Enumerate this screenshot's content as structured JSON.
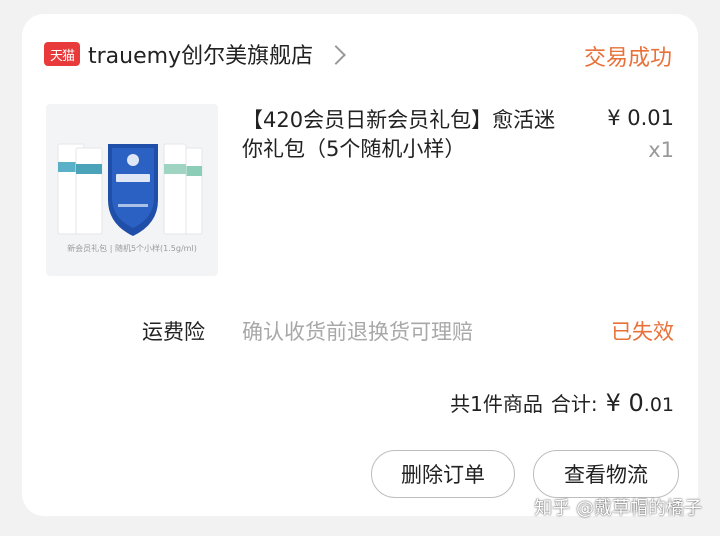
{
  "shop": {
    "badge": "天猫",
    "name": "trauemy创尔美旗舰店",
    "order_status": "交易成功"
  },
  "product": {
    "title": "【420会员日新会员礼包】愈活迷你礼包（5个随机小样）",
    "price": "¥ 0.01",
    "quantity": "x1",
    "image_caption": "新会员礼包 | 随机5个小样(1.5g/ml)"
  },
  "insurance": {
    "label": "运费险",
    "description": "确认收货前退换货可理赔",
    "status": "已失效"
  },
  "summary": {
    "count_text": "共1件商品",
    "total_label": "合计:",
    "currency": "¥",
    "amount_int": "0",
    "amount_dec": ".01"
  },
  "actions": {
    "delete_label": "删除订单",
    "logistics_label": "查看物流"
  },
  "watermark": "知乎 @戴草帽的橘子",
  "colors": {
    "accent": "#e8713a",
    "tmall_red": "#e83a3a",
    "muted": "#a8a8a8"
  }
}
